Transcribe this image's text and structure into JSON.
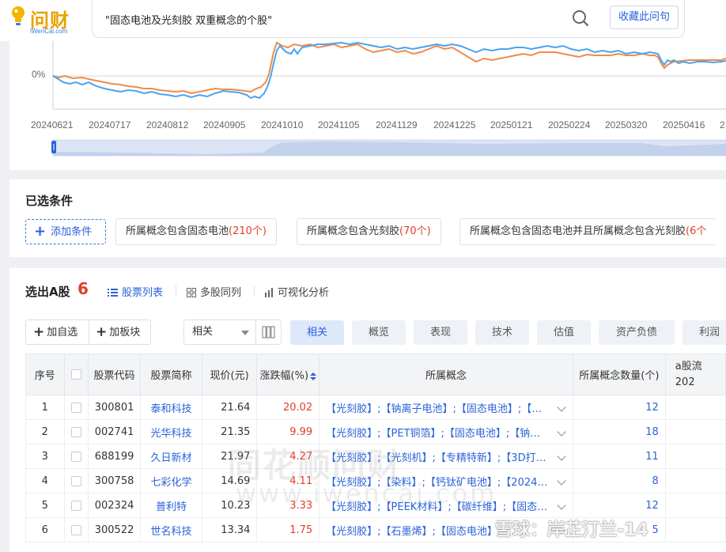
{
  "header": {
    "logo_text": "问财",
    "logo_sub": "iWenCai.com",
    "search_query": "\"固态电池及光刻胶 双重概念的个股\"",
    "collect_label": "收藏此问句"
  },
  "chart": {
    "zero_label": "0%",
    "x_ticks": [
      "20240621",
      "20240717",
      "20240812",
      "20240905",
      "20241010",
      "20241105",
      "20241129",
      "20241225",
      "20250121",
      "20250224",
      "20250320",
      "20250416",
      "2"
    ],
    "colors": {
      "series_a": "#f08a4b",
      "series_b": "#4aa3f0",
      "baseline": "#cccccc"
    }
  },
  "conditions": {
    "title": "已选条件",
    "add_label": "添加条件",
    "chips": [
      {
        "text": "所属概念包含固态电池",
        "count": "(210个)"
      },
      {
        "text": "所属概念包含光刻胶",
        "count": "(70个)"
      },
      {
        "text": "所属概念包含固态电池并且所属概念包含光刻胶",
        "count": "(6个"
      }
    ]
  },
  "results": {
    "title": "选出A股",
    "count": "6",
    "views": [
      "股票列表",
      "多股同列",
      "可视化分析"
    ],
    "add_watch": "加自选",
    "add_block": "加板块",
    "select_value": "相关",
    "segments": [
      "相关",
      "概览",
      "表现",
      "技术",
      "估值",
      "资产负债",
      "利润"
    ],
    "columns": [
      "序号",
      "",
      "股票代码",
      "股票简称",
      "现价(元)",
      "涨跌幅(%)",
      "所属概念",
      "所属概念数量(个)",
      "a股流",
      "202"
    ],
    "rows": [
      {
        "idx": "1",
        "code": "300801",
        "name": "泰和科技",
        "price": "21.64",
        "change": "20.02",
        "concept": "【光刻胶】;【钠离子电池】;【固态电池】;【…",
        "concept_count": "12"
      },
      {
        "idx": "2",
        "code": "002741",
        "name": "光华科技",
        "price": "21.35",
        "change": "9.99",
        "concept": "【光刻胶】;【PET铜箔】;【固态电池】;【钠…",
        "concept_count": "18"
      },
      {
        "idx": "3",
        "code": "688199",
        "name": "久日新材",
        "price": "21.97",
        "change": "4.27",
        "concept": "【光刻胶】;【光刻机】;【专精特新】;【3D打…",
        "concept_count": "11"
      },
      {
        "idx": "4",
        "code": "300758",
        "name": "七彩化学",
        "price": "14.69",
        "change": "4.11",
        "concept": "【光刻胶】;【染料】;【钙钛矿电池】;【2024…",
        "concept_count": "8"
      },
      {
        "idx": "5",
        "code": "002324",
        "name": "普利特",
        "price": "10.23",
        "change": "3.33",
        "concept": "【光刻胶】;【PEEK材料】;【碳纤维】;【固态…",
        "concept_count": "12"
      },
      {
        "idx": "6",
        "code": "300522",
        "name": "世名科技",
        "price": "13.34",
        "change": "1.75",
        "concept": "【光刻胶】;【石墨烯】;【固态电池】;【…",
        "concept_count": "5"
      }
    ]
  },
  "watermarks": {
    "main": "同花顺问财",
    "url": "www.iwencai.com",
    "xueqiu": "雪球：岸芷汀兰-14"
  }
}
